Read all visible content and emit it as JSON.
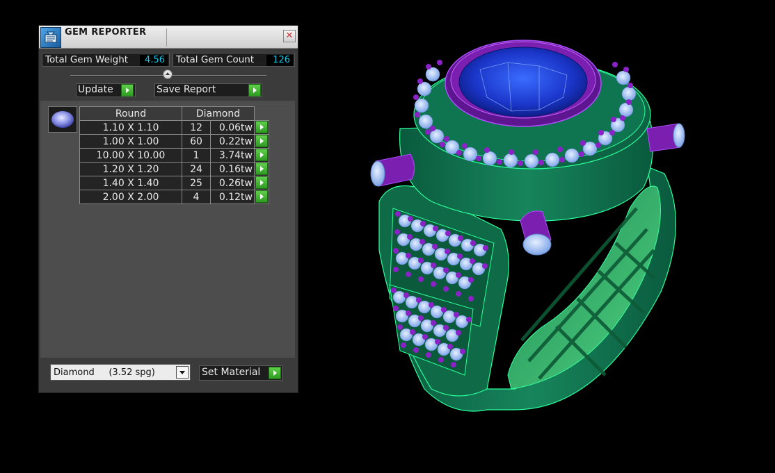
{
  "window": {
    "title": "GEM REPORTER",
    "close_glyph": "✕"
  },
  "stats": {
    "total_weight_label": "Total Gem Weight",
    "total_weight_value": "4.56",
    "total_count_label": "Total Gem Count",
    "total_count_value": "126"
  },
  "toolbar": {
    "update_label": "Update",
    "save_report_label": "Save Report"
  },
  "table": {
    "headers": [
      "Round",
      "Diamond"
    ],
    "rows": [
      {
        "size": "1.10 X 1.10",
        "count": "12",
        "weight": "0.06tw"
      },
      {
        "size": "1.00 X 1.00",
        "count": "60",
        "weight": "0.22tw"
      },
      {
        "size": "10.00 X 10.00",
        "count": "1",
        "weight": "3.74tw"
      },
      {
        "size": "1.20 X 1.20",
        "count": "24",
        "weight": "0.16tw"
      },
      {
        "size": "1.40 X 1.40",
        "count": "25",
        "weight": "0.26tw"
      },
      {
        "size": "2.00 X 2.00",
        "count": "4",
        "weight": "0.12tw"
      }
    ]
  },
  "material": {
    "selected": "Diamond     (3.52 spg)",
    "set_label": "Set Material"
  },
  "icons": {
    "app": "gem-reporter-app-icon",
    "gem_thumbnail": "round-gem-icon"
  },
  "colors": {
    "value_text": "#19c8e6",
    "action_green": "#3fb52e",
    "ring_metal": "#0d6b4d",
    "prongs": "#7a1fb0",
    "center_stone": "#1f3fd0"
  }
}
